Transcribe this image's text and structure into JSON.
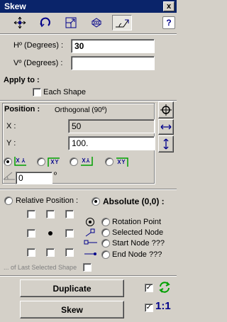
{
  "window": {
    "title": "Skew",
    "close": "x"
  },
  "toolbar": {
    "tools": [
      "move-tool-icon",
      "rotate-tool-icon",
      "scale-tool-icon",
      "reflect-tool-icon",
      "skew-tool-icon"
    ],
    "active": "skew-tool-icon",
    "help": "?"
  },
  "fields": {
    "h_label": "Hº (Degrees) :",
    "h_value": "30",
    "v_label": "Vº (Degrees) :",
    "v_value": ""
  },
  "apply": {
    "label": "Apply to :",
    "each_shape": "Each Shape"
  },
  "position": {
    "label": "Position :",
    "mode": "Orthogonal (90º)",
    "x_label": "X :",
    "x_value": "50",
    "y_label": "Y :",
    "y_value": "100.",
    "angle_value": "0",
    "angle_unit": "º"
  },
  "reference": {
    "relative_label": "Relative Position :",
    "absolute_label": "Absolute (0,0) :",
    "options": [
      "Rotation Point",
      "Selected Node",
      "Start Node ???",
      "End Node ???"
    ],
    "last_selected": "... of Last Selected Shape"
  },
  "actions": {
    "duplicate": "Duplicate",
    "skew": "Skew",
    "scale_label": "1:1"
  }
}
